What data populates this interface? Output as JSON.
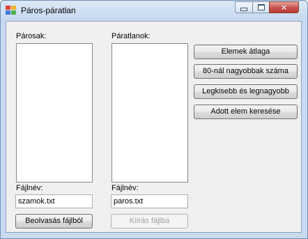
{
  "window": {
    "title": "Páros-páratlan"
  },
  "left": {
    "list_label": "Párosak:",
    "file_label": "Fájlnév:",
    "file_value": "szamok.txt",
    "button_label": "Beolvasás fájlból"
  },
  "middle": {
    "list_label": "Páratlanok:",
    "file_label": "Fájlnév:",
    "file_value": "paros.txt",
    "button_label": "Kiírás fájlba"
  },
  "actions": {
    "average": "Elemek átlaga",
    "over80": "80-nál nagyobbak száma",
    "minmax": "Legkisebb és legnagyobb",
    "search": "Adott elem keresése"
  },
  "icons": {
    "app": "app-form-icon",
    "minimize": "minimize-icon",
    "maximize": "maximize-icon",
    "close": "close-icon"
  }
}
